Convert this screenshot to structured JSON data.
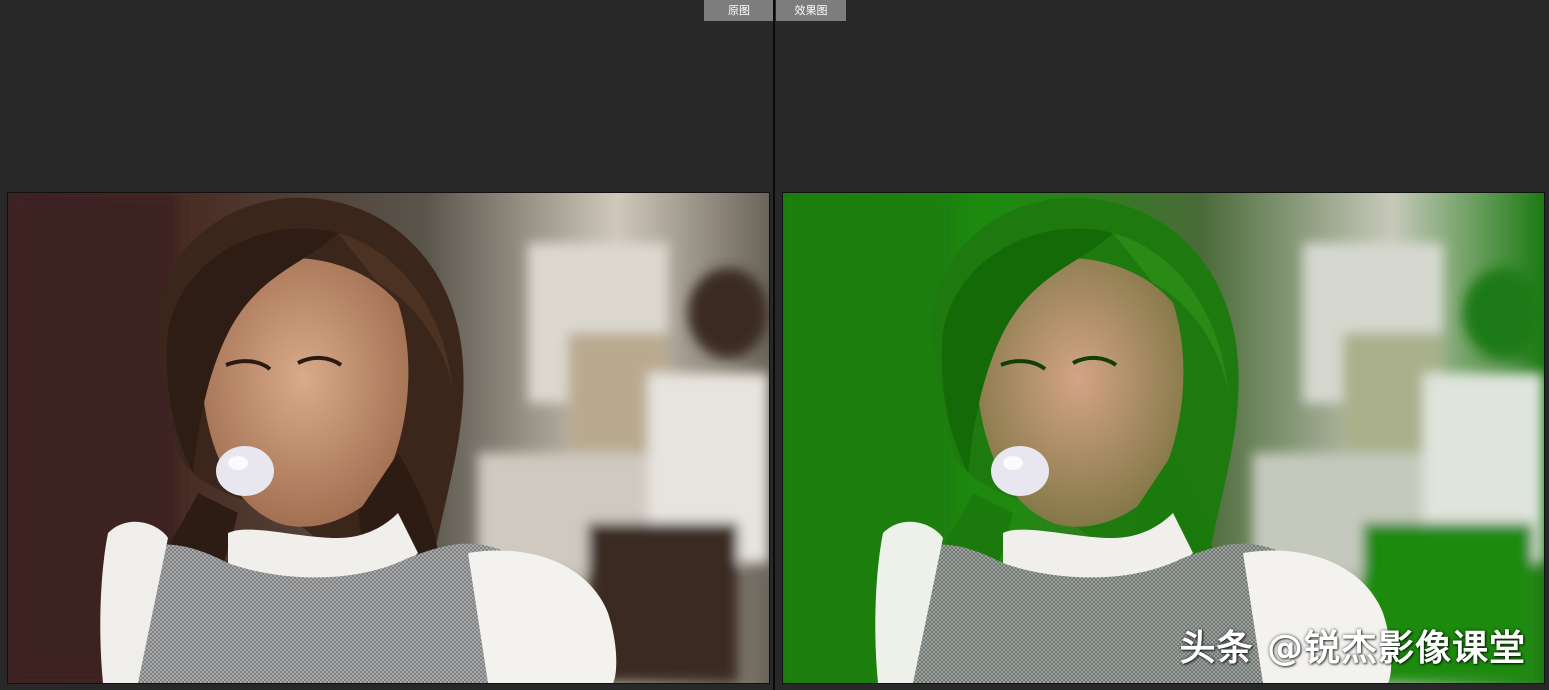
{
  "tabs": {
    "before_label": "原图",
    "after_label": "效果图"
  },
  "panels": {
    "left": {
      "name": "original-photo"
    },
    "right": {
      "name": "effect-photo"
    }
  },
  "watermark": "头条 @锐杰影像课堂",
  "colors": {
    "background": "#282828",
    "tab": "#7d7d7d",
    "divider": "#0a0a0a",
    "effect_tint": "#1f8a10"
  }
}
